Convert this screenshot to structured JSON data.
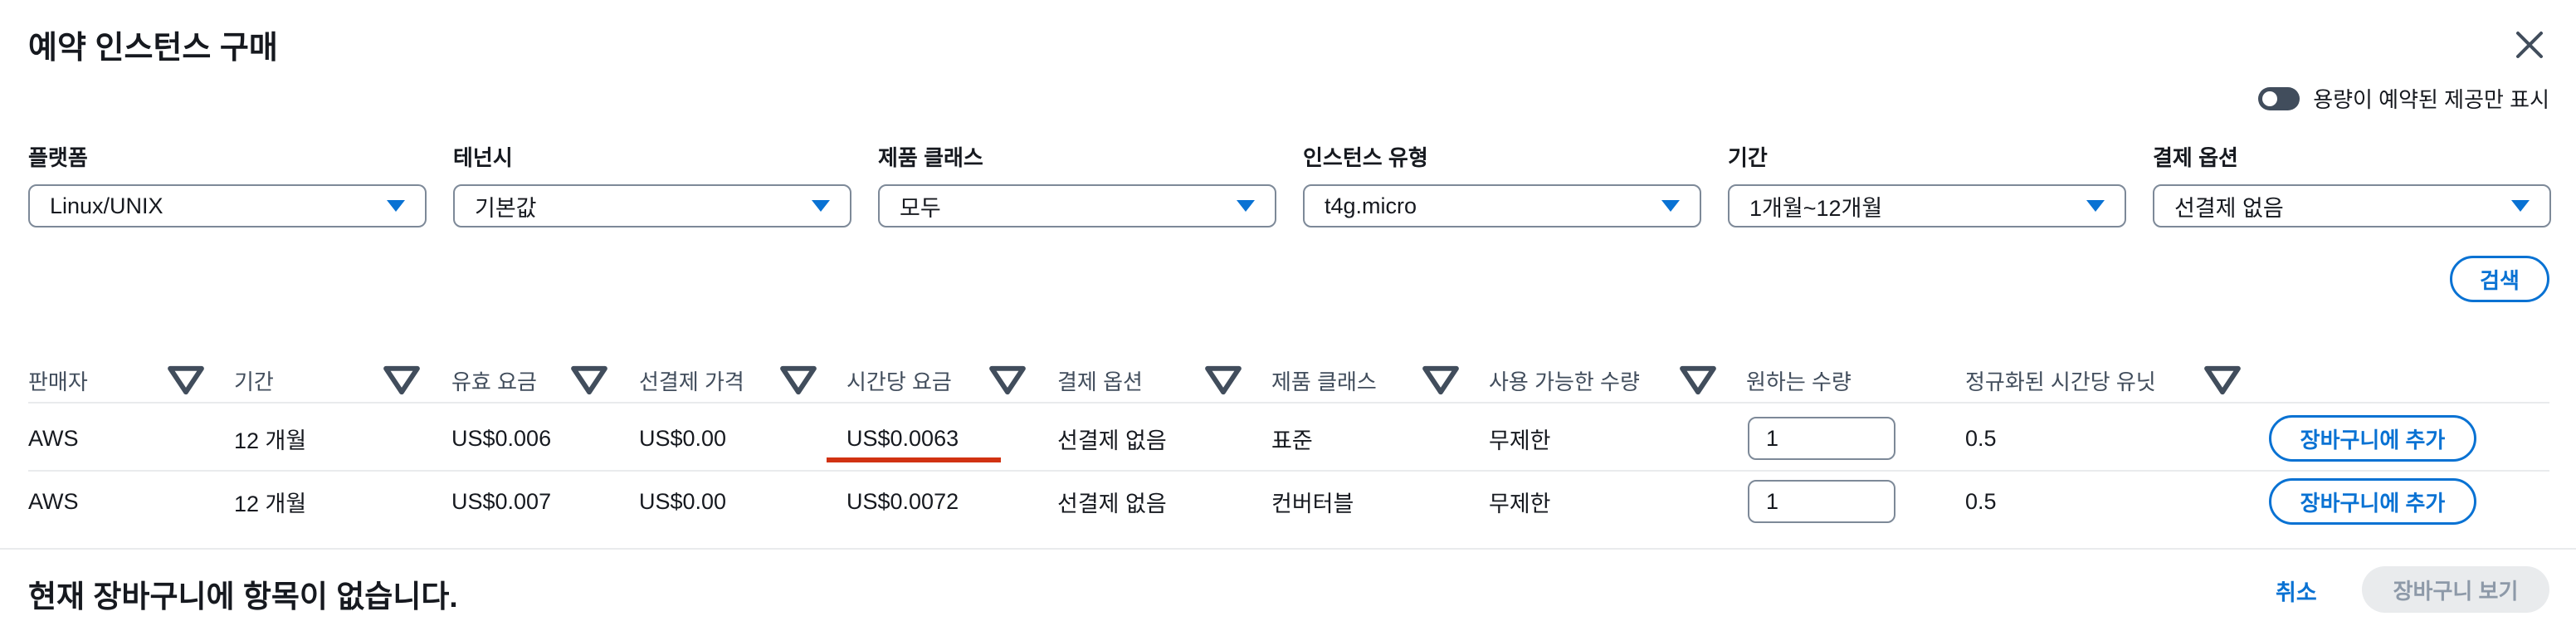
{
  "dialog": {
    "title": "예약 인스턴스 구매",
    "close_icon": "close-icon",
    "toggle_label": "용량이 예약된 제공만 표시",
    "toggle_on": true
  },
  "filters": [
    {
      "label": "플랫폼",
      "value": "Linux/UNIX"
    },
    {
      "label": "테넌시",
      "value": "기본값"
    },
    {
      "label": "제품 클래스",
      "value": "모두"
    },
    {
      "label": "인스턴스 유형",
      "value": "t4g.micro"
    },
    {
      "label": "기간",
      "value": "1개월~12개월"
    },
    {
      "label": "결제 옵션",
      "value": "선결제 없음"
    }
  ],
  "search_label": "검색",
  "columns": [
    "판매자",
    "기간",
    "유효 요금",
    "선결제 가격",
    "시간당 요금",
    "결제 옵션",
    "제품 클래스",
    "사용 가능한 수량",
    "원하는 수량",
    "정규화된 시간당 유닛"
  ],
  "rows": [
    {
      "seller": "AWS",
      "term": "12 개월",
      "effective_rate": "US$0.006",
      "upfront": "US$0.00",
      "hourly": "US$0.0063",
      "payment": "선결제 없음",
      "class": "표준",
      "available": "무제한",
      "desired": "1",
      "units": "0.5",
      "add_label": "장바구니에 추가"
    },
    {
      "seller": "AWS",
      "term": "12 개월",
      "effective_rate": "US$0.007",
      "upfront": "US$0.00",
      "hourly": "US$0.0072",
      "payment": "선결제 없음",
      "class": "컨버터블",
      "available": "무제한",
      "desired": "1",
      "units": "0.5",
      "add_label": "장바구니에 추가"
    }
  ],
  "footer": {
    "message": "현재 장바구니에 항목이 없습니다.",
    "cancel_label": "취소",
    "view_cart_label": "장바구니 보기"
  },
  "colors": {
    "accent": "#0972d3",
    "highlight_underline": "#d13212",
    "toggle": "#414d5c"
  }
}
